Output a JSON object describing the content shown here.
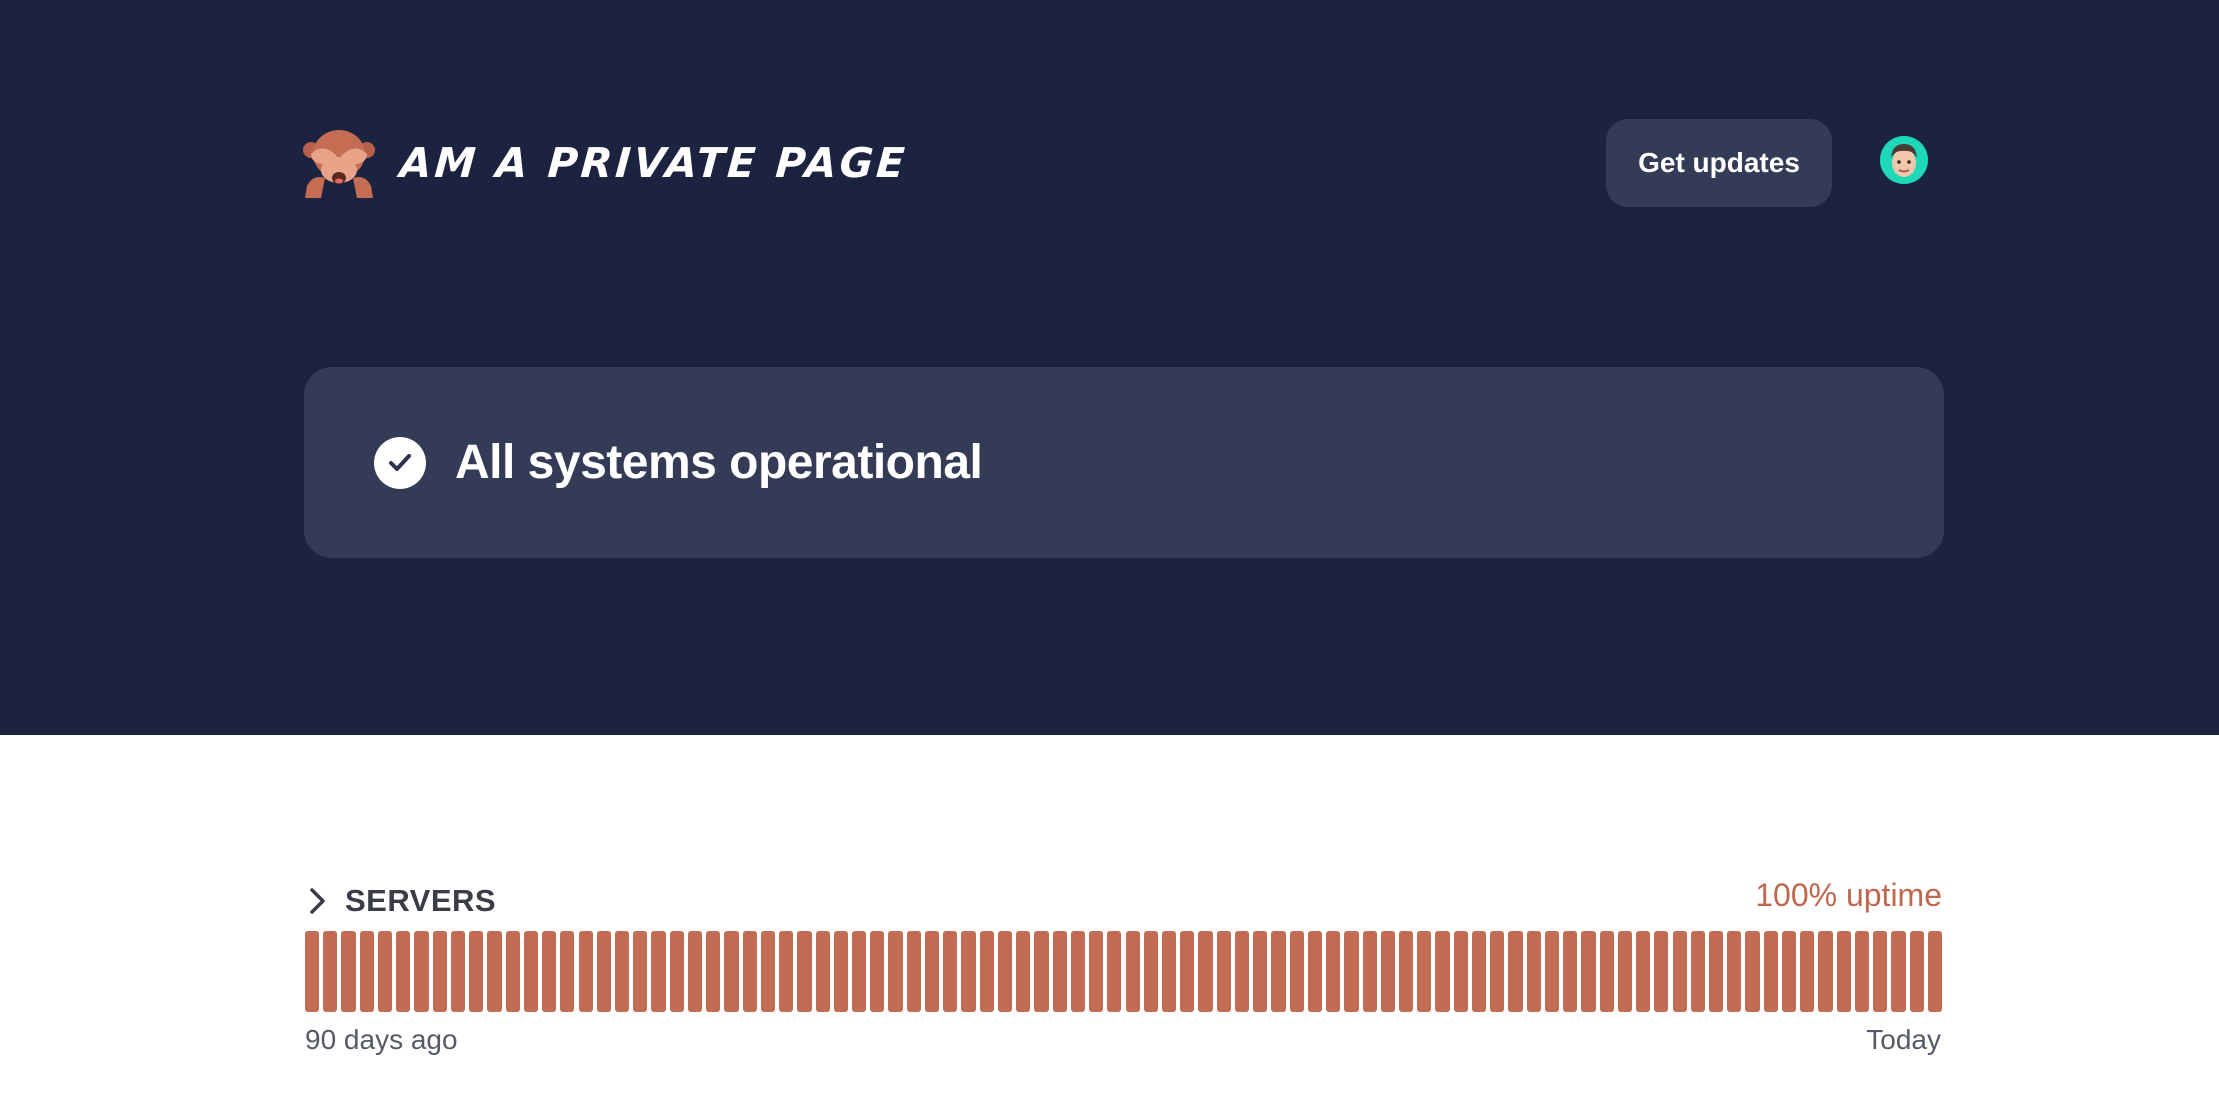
{
  "header": {
    "title": "AM A PRIVATE PAGE",
    "logo_icon": "see-no-evil-monkey-icon",
    "get_updates_label": "Get updates",
    "avatar_icon": "memoji-avatar-icon"
  },
  "status": {
    "icon": "check-circle-icon",
    "text": "All systems operational"
  },
  "group": {
    "name": "SERVERS",
    "uptime_label": "100% uptime",
    "range_start": "90 days ago",
    "range_end": "Today",
    "days": 90,
    "bar_color": "#c26c54"
  },
  "colors": {
    "hero_bg": "#1c2341",
    "card_bg": "#333b56",
    "accent": "#c0684f",
    "avatar_bg": "#1ed8b8"
  }
}
